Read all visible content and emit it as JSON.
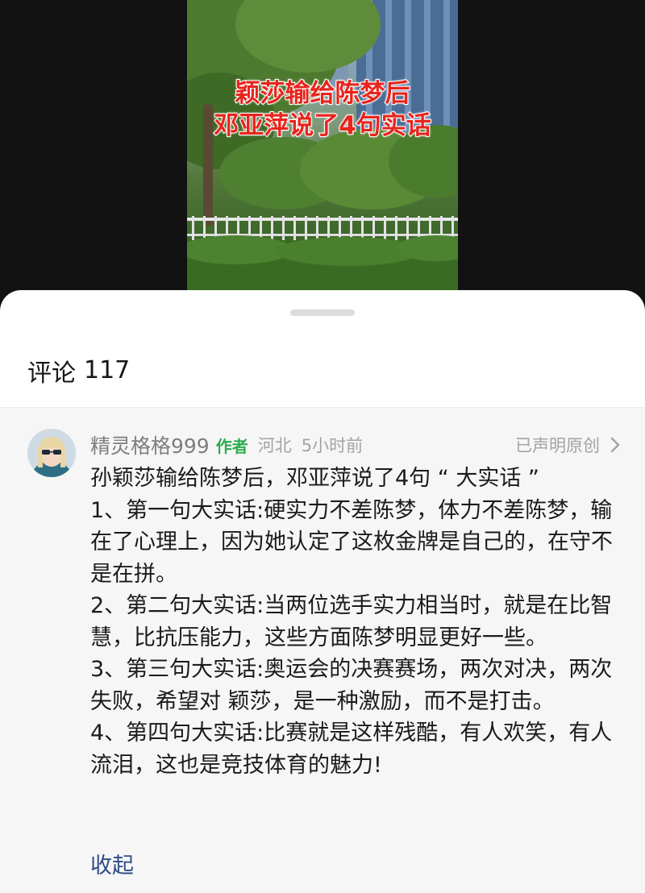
{
  "video": {
    "caption_line1": "颖莎输给陈梦后",
    "caption_line2": "邓亚萍说了4句实话"
  },
  "comments_panel": {
    "title": "评论",
    "count": "117"
  },
  "comment": {
    "username": "精灵格格999",
    "author_tag": "作者",
    "region": "河北",
    "time": "5小时前",
    "original_label": "已声明原创",
    "paragraphs": [
      "孙颖莎输给陈梦后，邓亚萍说了4句 “ 大实话 ”",
      "1、第一句大实话:硬实力不差陈梦，体力不差陈梦，输在了心理上，因为她认定了这枚金牌是自己的，在守不是在拼。",
      "2、第二句大实话:当两位选手实力相当时，就是在比智慧，比抗压能力，这些方面陈梦明显更好一些。",
      "3、第三句大实话:奥运会的决赛赛场，两次对决，两次失败，希望对 颖莎，是一种激励，而不是打击。",
      "4、第四句大实话:比赛就是这样残酷，有人欢笑，有人流泪，这也是竞技体育的魅力!"
    ],
    "collapse_label": "收起"
  },
  "colors": {
    "author_tag": "#2dab4f",
    "collapse_link": "#2f4c85",
    "caption": "#e8241c"
  }
}
